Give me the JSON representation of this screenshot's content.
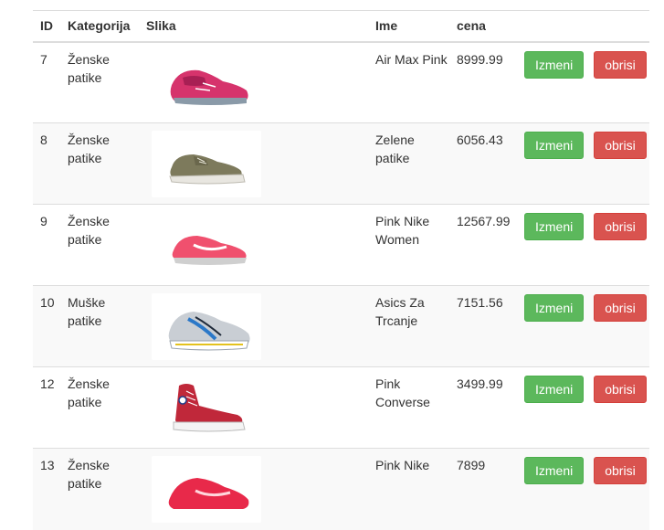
{
  "table": {
    "headers": {
      "id": "ID",
      "category": "Kategorija",
      "image": "Slika",
      "name": "Ime",
      "price": "cena"
    },
    "actions": {
      "edit": "Izmeni",
      "delete": "obrisi"
    },
    "rows": [
      {
        "id": "7",
        "category": "Ženske patike",
        "name": "Air Max Pink",
        "price": "8999.99",
        "image_desc": "pink running shoe"
      },
      {
        "id": "8",
        "category": "Ženske patike",
        "name": "Zelene patike",
        "price": "6056.43",
        "image_desc": "olive canvas sneaker"
      },
      {
        "id": "9",
        "category": "Ženske patike",
        "name": "Pink Nike Women",
        "price": "12567.99",
        "image_desc": "pink nike running shoe"
      },
      {
        "id": "10",
        "category": "Muške patike",
        "name": "Asics Za Trcanje",
        "price": "7151.56",
        "image_desc": "grey blue asics running shoe"
      },
      {
        "id": "12",
        "category": "Ženske patike",
        "name": "Pink Converse",
        "price": "3499.99",
        "image_desc": "red high-top converse"
      },
      {
        "id": "13",
        "category": "Ženske patike",
        "name": "Pink Nike",
        "price": "7899",
        "image_desc": "red nike running shoe"
      }
    ]
  },
  "colors": {
    "edit_button": "#5cb85c",
    "delete_button": "#d9534f",
    "stripe": "#f9f9f9"
  }
}
